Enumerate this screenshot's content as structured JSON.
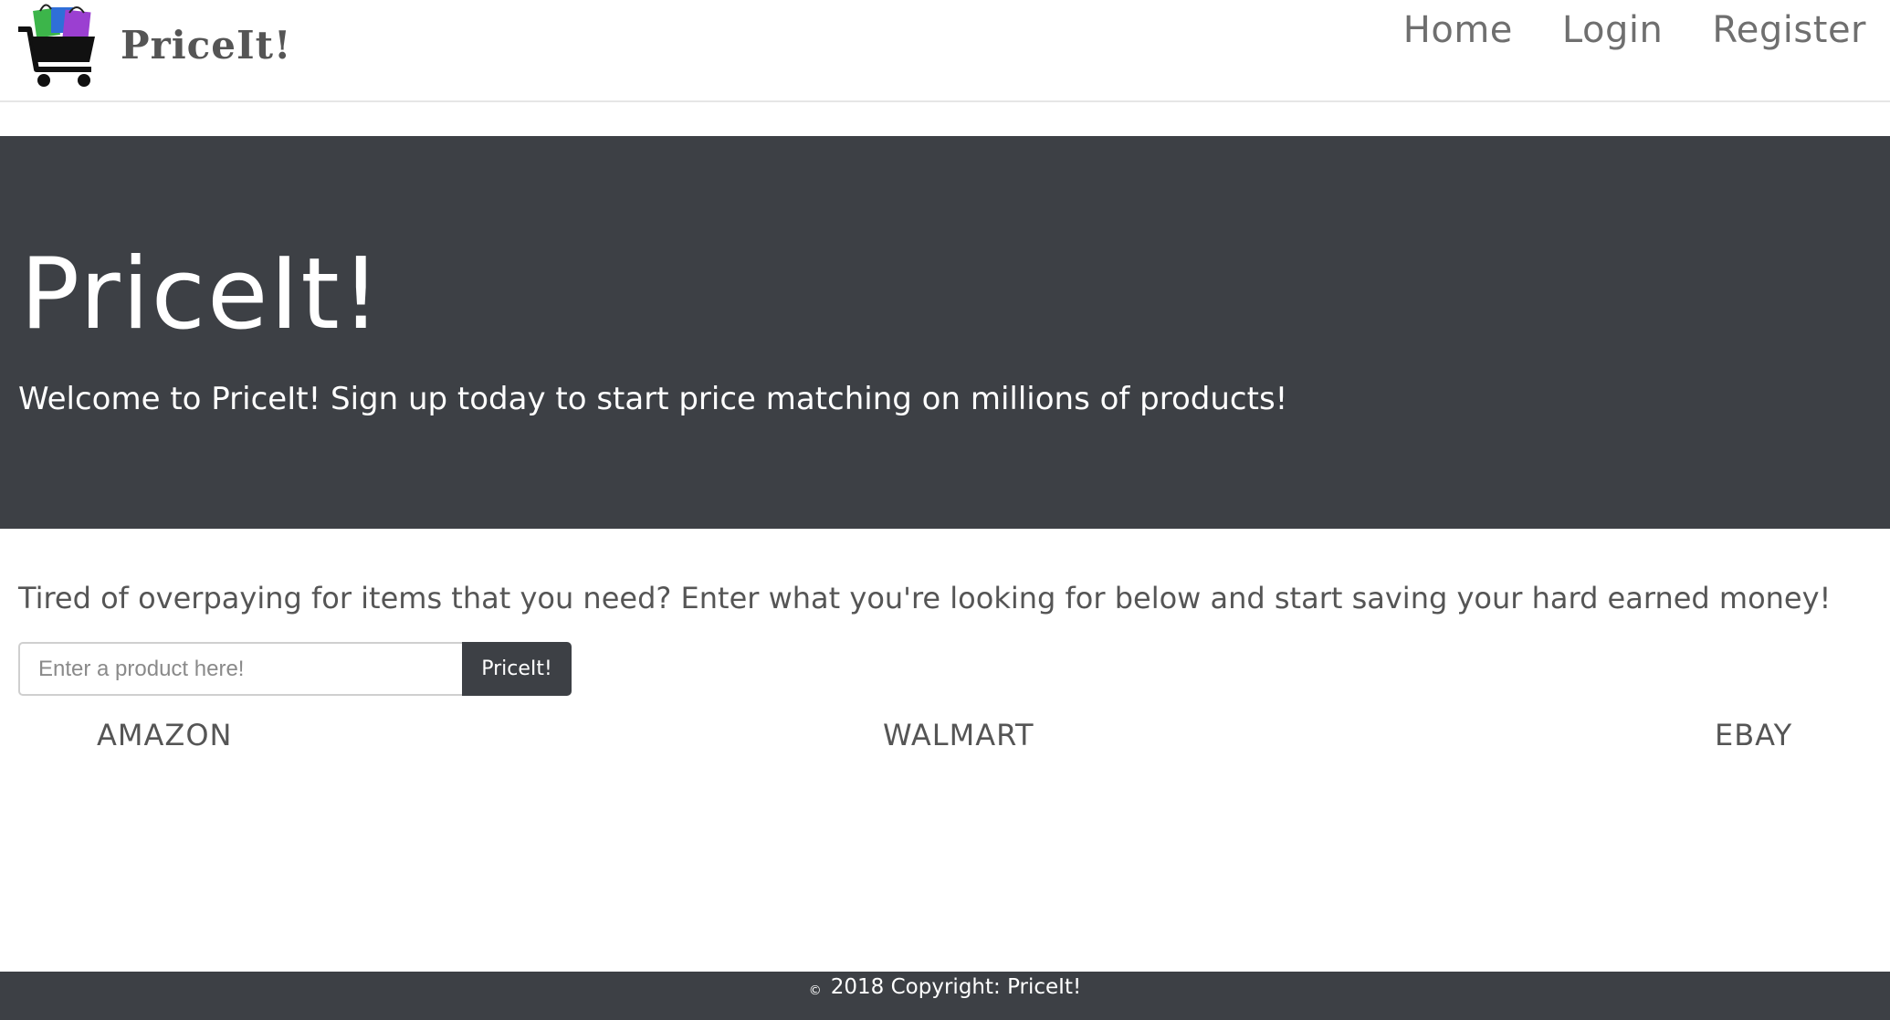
{
  "navbar": {
    "brand_text": "PriceIt!",
    "logo_icon": "shopping-cart-with-bags-icon",
    "links": [
      {
        "label": "Home"
      },
      {
        "label": "Login"
      },
      {
        "label": "Register"
      }
    ]
  },
  "hero": {
    "title": "PriceIt!",
    "lead": "Welcome to PriceIt! Sign up today to start price matching on millions of products!",
    "background": "#3d4045"
  },
  "main": {
    "intro": "Tired of overpaying for items that you need? Enter what you're looking for below and start saving your hard earned money!",
    "search": {
      "placeholder": "Enter a product here!",
      "value": "",
      "button_label": "PriceIt!"
    },
    "stores": [
      "AMAZON",
      "WALMART",
      "EBAY"
    ]
  },
  "footer": {
    "copyright_symbol": "©",
    "text": "2018 Copyright: PriceIt!"
  },
  "colors": {
    "dark": "#3d4045",
    "nav_text": "#6f6f6f",
    "body_text": "#555555"
  }
}
